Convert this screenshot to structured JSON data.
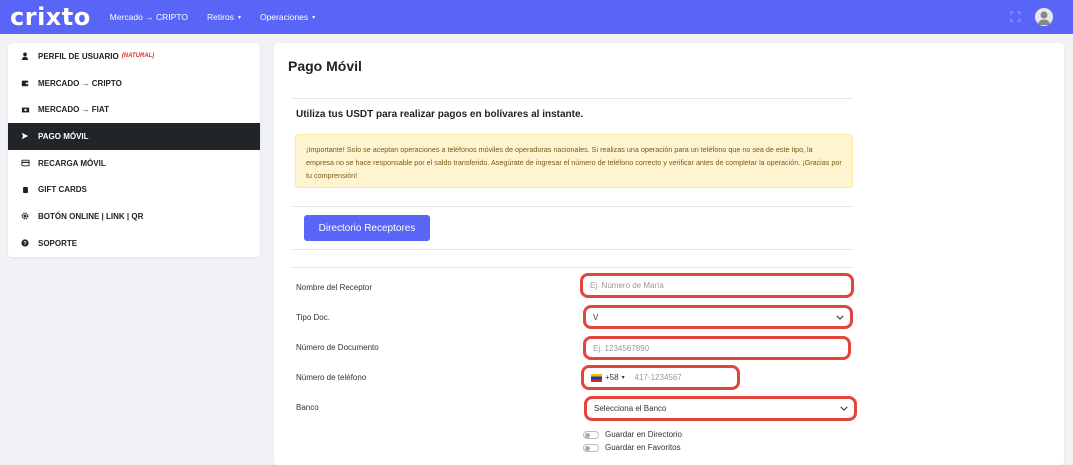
{
  "navbar": {
    "logo": "crixto",
    "links": [
      {
        "label": "Mercado → CRIPTO",
        "has_caret": false
      },
      {
        "label": "Retiros",
        "has_caret": true
      },
      {
        "label": "Operaciones",
        "has_caret": true
      }
    ],
    "caret_glyph": "▾",
    "bg_color": "#5865f7"
  },
  "sidebar": {
    "items": [
      {
        "label": "PERFIL DE USUARIO",
        "icon": "user-icon",
        "badge": "(NATURAL)",
        "active": false
      },
      {
        "label": "MERCADO → CRIPTO",
        "icon": "wallet-icon",
        "active": false
      },
      {
        "label": "MERCADO → FIAT",
        "icon": "money-icon",
        "active": false
      },
      {
        "label": "PAGO MÓVIL",
        "icon": "send-icon",
        "active": true
      },
      {
        "label": "RECARGA MÓVIL",
        "icon": "card-icon",
        "active": false
      },
      {
        "label": "GIFT CARDS",
        "icon": "database-icon",
        "active": false
      },
      {
        "label": "BOTÓN ONLINE | LINK | QR",
        "icon": "gear-icon",
        "active": false
      },
      {
        "label": "SOPORTE",
        "icon": "help-icon",
        "active": false
      }
    ]
  },
  "main": {
    "title": "Pago Móvil",
    "subtitle": "Utiliza tus USDT para realizar pagos en bolívares al instante.",
    "alert": "¡Importante! Solo se aceptan operaciones a teléfonos móviles de operadoras nacionales. Si realizas una operación para un teléfono que no sea de este tipo, la empresa no se hace responsable por el saldo transferido. Asegúrate de ingresar el número de teléfono correcto y verificar antes de completar la operación. ¡Gracias por tu comprensión!",
    "directory_button": "Directorio Receptores",
    "form": {
      "receiver_name_label": "Nombre del Receptor",
      "receiver_name_placeholder": "Ej. Número de María",
      "doc_type_label": "Tipo Doc.",
      "doc_type_value": "V",
      "doc_number_label": "Número de Documento",
      "doc_number_placeholder": "Ej. 1234567890",
      "phone_label": "Número de teléfono",
      "phone_prefix": "+58",
      "phone_prefix_caret": "▾",
      "phone_placeholder": "417-1234567",
      "bank_label": "Banco",
      "bank_value": "Selecciona el Banco",
      "save_directory_label": "Guardar en Directorio",
      "save_favorites_label": "Guardar en Favoritos"
    }
  },
  "colors": {
    "highlight": "#e0463c",
    "primary": "#5865f7",
    "alert_bg": "#fff4d0"
  }
}
